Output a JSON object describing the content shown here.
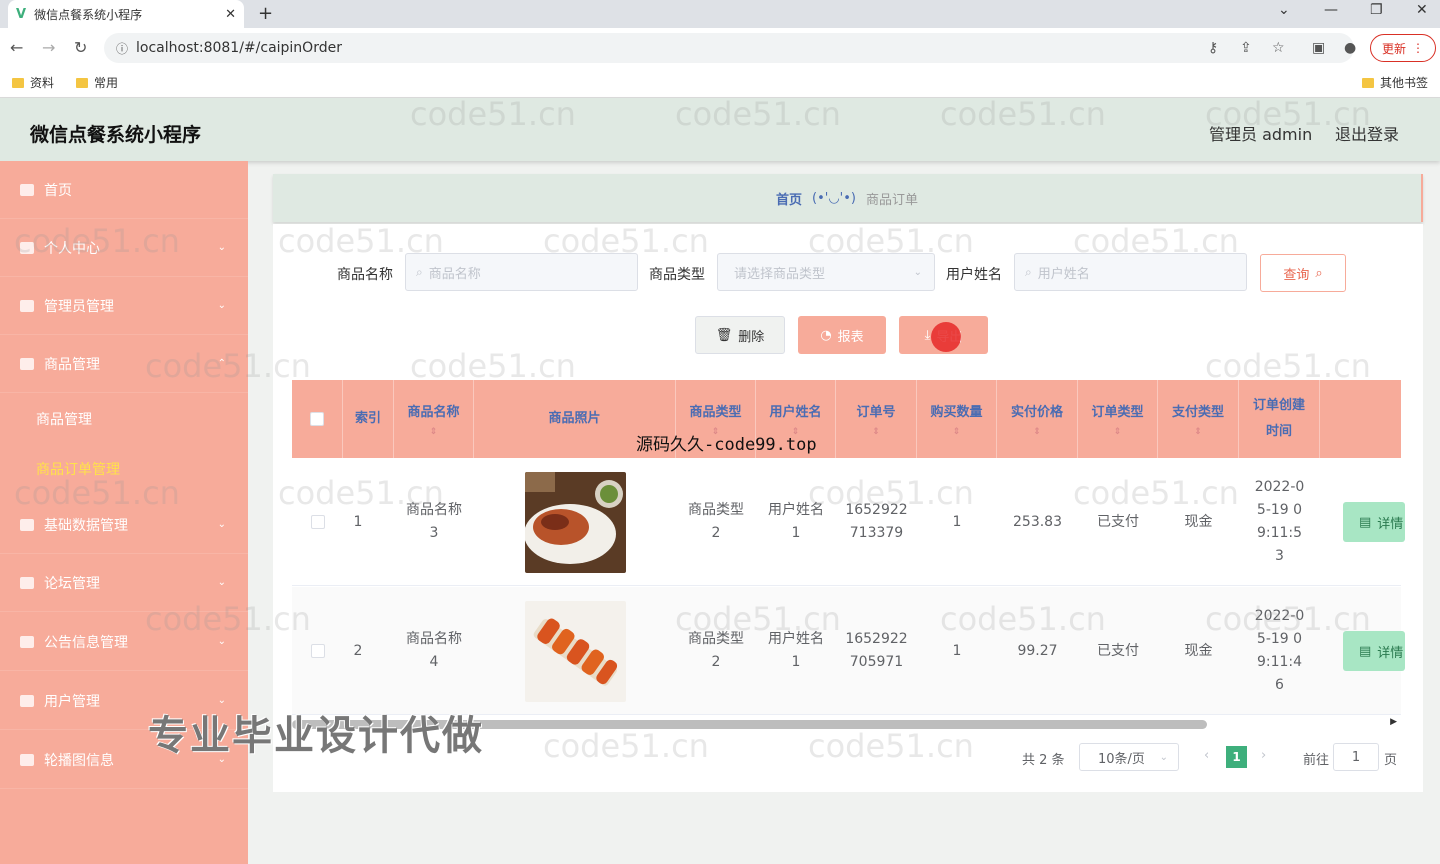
{
  "browser": {
    "tab_title": "微信点餐系统小程序",
    "url": "localhost:8081/#/caipinOrder",
    "update_label": "更新",
    "bookmarks": [
      "资料",
      "常用"
    ],
    "other_bookmarks": "其他书签"
  },
  "header": {
    "title": "微信点餐系统小程序",
    "admin": "管理员 admin",
    "logout": "退出登录"
  },
  "sidebar": {
    "items": [
      {
        "label": "首页"
      },
      {
        "label": "个人中心"
      },
      {
        "label": "管理员管理"
      },
      {
        "label": "商品管理"
      },
      {
        "label": "基础数据管理"
      },
      {
        "label": "论坛管理"
      },
      {
        "label": "公告信息管理"
      },
      {
        "label": "用户管理"
      },
      {
        "label": "轮播图信息"
      }
    ],
    "subitems": [
      {
        "label": "商品管理"
      },
      {
        "label": "商品订单管理"
      }
    ]
  },
  "breadcrumb": {
    "home": "首页",
    "face": "(•'◡'•)",
    "current": "商品订单"
  },
  "filters": {
    "name_label": "商品名称",
    "name_placeholder": "商品名称",
    "type_label": "商品类型",
    "type_placeholder": "请选择商品类型",
    "user_label": "用户姓名",
    "user_placeholder": "用户姓名",
    "query": "查询"
  },
  "actions": {
    "delete": "删除",
    "report": "报表",
    "export": "导出"
  },
  "table": {
    "headers": [
      "索引",
      "商品名称",
      "商品照片",
      "商品类型",
      "用户姓名",
      "订单号",
      "购买数量",
      "实付价格",
      "订单类型",
      "支付类型",
      "订单创建时间"
    ],
    "rows": [
      {
        "index": "1",
        "name": "商品名称3",
        "type": "商品类型2",
        "user": "用户姓名1",
        "order_no": "1652922713379",
        "qty": "1",
        "price": "253.83",
        "order_type": "已支付",
        "pay_type": "现金",
        "created": "2022-05-19 09:11:53",
        "detail": "详情"
      },
      {
        "index": "2",
        "name": "商品名称4",
        "type": "商品类型2",
        "user": "用户姓名1",
        "order_no": "1652922705971",
        "qty": "1",
        "price": "99.27",
        "order_type": "已支付",
        "pay_type": "现金",
        "created": "2022-05-19 09:11:46",
        "detail": "详情"
      }
    ]
  },
  "pagination": {
    "total": "共 2 条",
    "page_size": "10条/页",
    "current": "1",
    "goto_label": "前往",
    "goto_value": "1",
    "page_suffix": "页"
  },
  "overlays": {
    "source": "源码久久-code99.top",
    "promo": "专业毕业设计代做",
    "watermark": "code51.cn"
  },
  "colors": {
    "accent": "#f7ab9a",
    "header_bg": "#dfe9e2",
    "link": "#4a6cb3",
    "pager": "#3eaf7c"
  }
}
